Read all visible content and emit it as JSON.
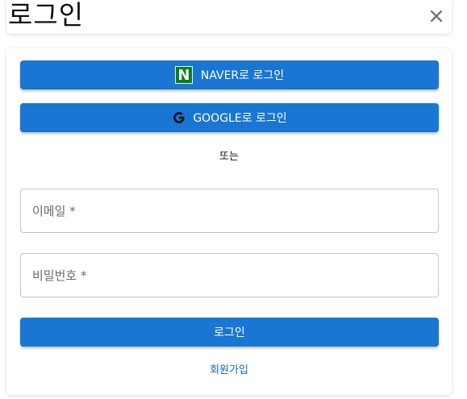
{
  "header": {
    "title": "로그인",
    "close_icon": "close-icon"
  },
  "social": {
    "naver_logo_letter": "N",
    "naver_label": "NAVER로 로그인",
    "google_label": "GOOGLE로 로그인",
    "naver_color": "#0a7d1f",
    "button_color": "#1976d2"
  },
  "divider": "또는",
  "form": {
    "email_label": "이메일 *",
    "password_label": "비밀번호 *",
    "submit_label": "로그인"
  },
  "signup_link": "회원가입"
}
